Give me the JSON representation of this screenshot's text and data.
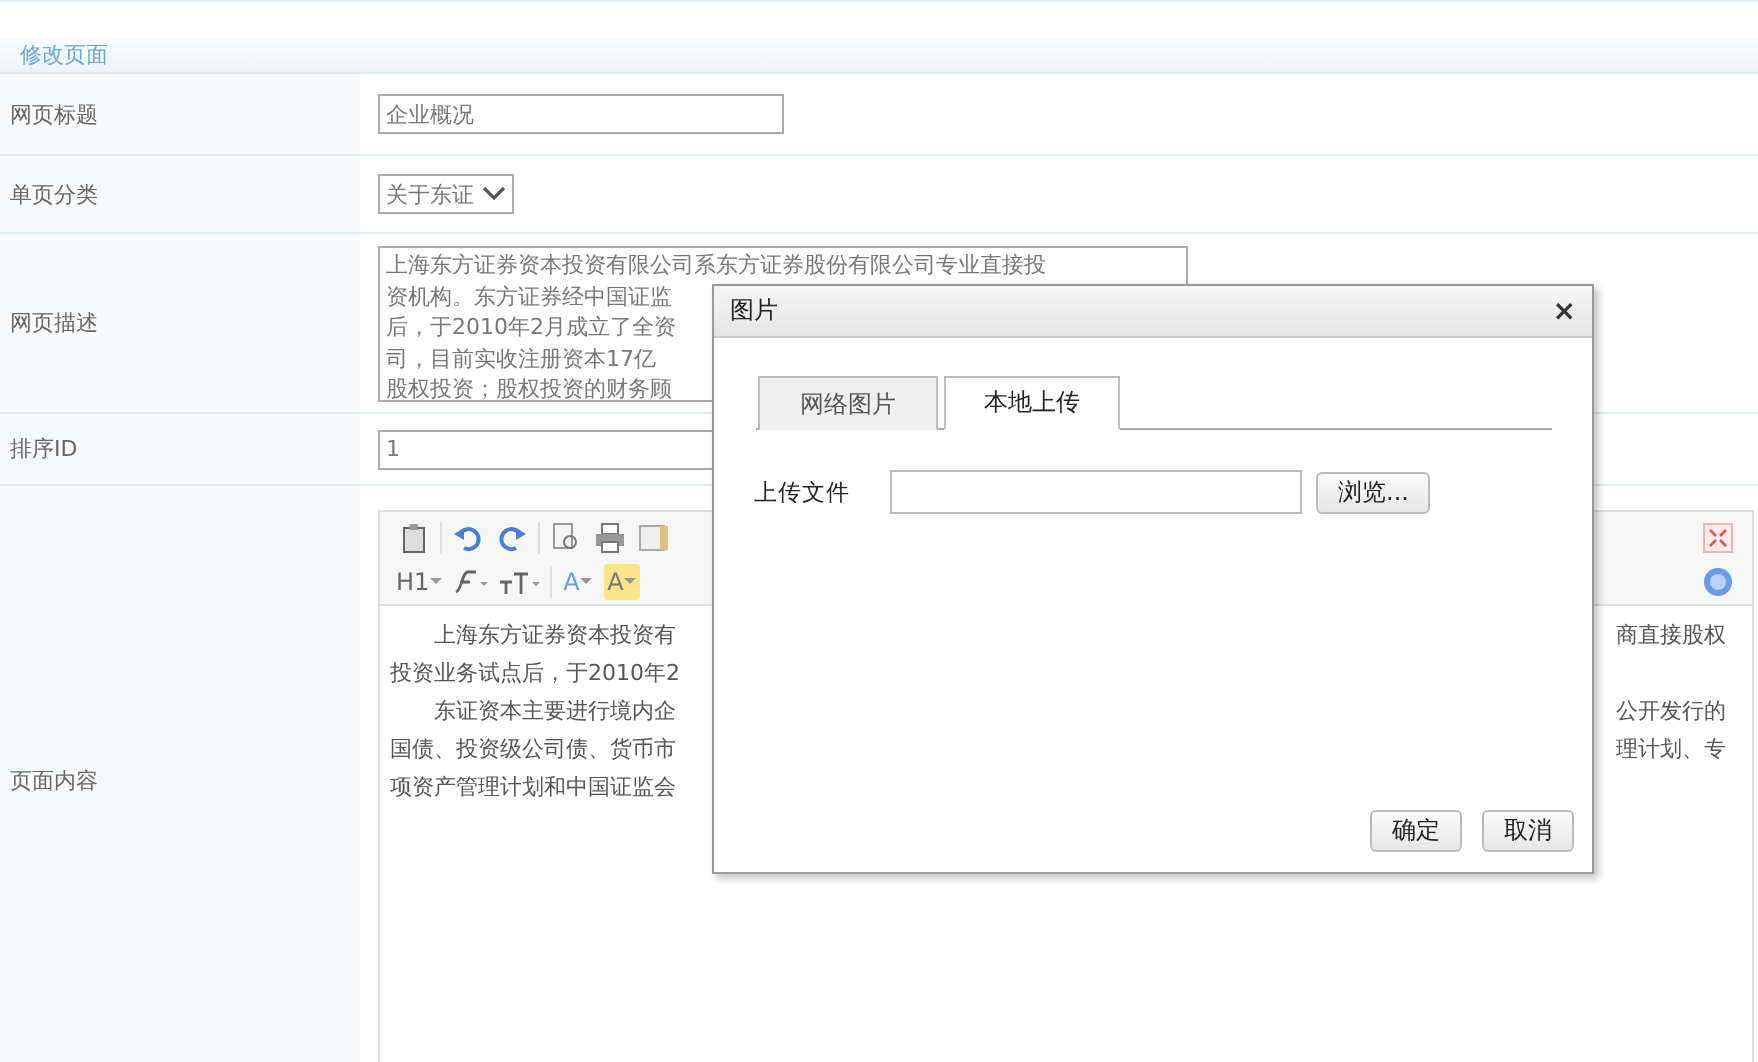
{
  "section_title": "修改页面",
  "fields": [
    {
      "kind": "text",
      "label": "网页标题",
      "value": "企业概况"
    },
    {
      "kind": "select",
      "label": "单页分类",
      "value": "关于东证"
    },
    {
      "kind": "textarea",
      "label": "网页描述",
      "lines": [
        "上海东方证券资本投资有限公司系东方证券股份有限公司专业直接投",
        "资机构。东方证券经中国证监",
        "后，于2010年2月成立了全资",
        "司，目前实收注册资本17亿",
        "股权投资；股权投资的财务顾"
      ]
    },
    {
      "kind": "text",
      "label": "排序ID",
      "value": "1"
    },
    {
      "kind": "editor",
      "label": "页面内容"
    }
  ],
  "editor": {
    "toolbar_rows": [
      [
        {
          "kind": "paste"
        },
        {
          "kind": "sep"
        },
        {
          "kind": "undo"
        },
        {
          "kind": "redo"
        },
        {
          "kind": "sep"
        },
        {
          "kind": "preview"
        },
        {
          "kind": "print"
        },
        {
          "kind": "template"
        }
      ],
      [
        {
          "kind": "heading",
          "label": "H1"
        },
        {
          "kind": "font"
        },
        {
          "kind": "size"
        },
        {
          "kind": "sep"
        },
        {
          "kind": "color",
          "label": "A"
        },
        {
          "kind": "highlight",
          "label": "A"
        }
      ]
    ],
    "toolbar_right": [
      {
        "kind": "fullscreen"
      },
      {
        "kind": "help"
      }
    ],
    "lines": [
      {
        "indent": true,
        "left": "上海东方证券资本投资有",
        "right": "商直接股权"
      },
      {
        "indent": false,
        "left": "投资业务试点后，于2010年2"
      },
      {
        "indent": true,
        "left": "东证资本主要进行境内企",
        "right": "公开发行的"
      },
      {
        "indent": false,
        "left": "国债、投资级公司债、货币市",
        "right": "理计划、专"
      },
      {
        "indent": false,
        "left": "项资产管理计划和中国证监会"
      }
    ]
  },
  "dialog": {
    "title": "图片",
    "close": "×",
    "tabs": [
      {
        "label": "网络图片",
        "selected": false
      },
      {
        "label": "本地上传",
        "selected": true
      }
    ],
    "upload_label": "上传文件",
    "browse": "浏览...",
    "buttons": [
      "确定",
      "取消"
    ]
  }
}
